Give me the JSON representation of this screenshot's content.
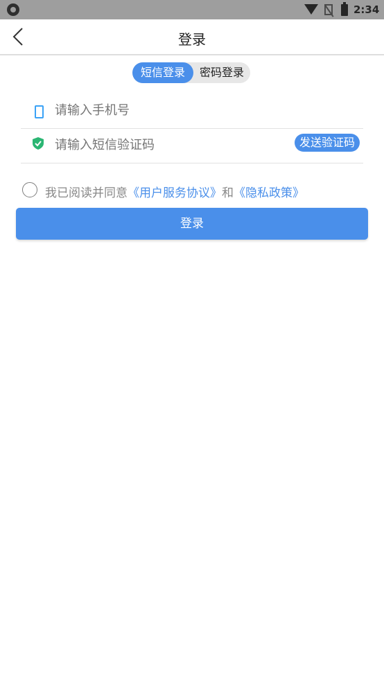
{
  "status_bar": {
    "time": "2:34"
  },
  "header": {
    "title": "登录"
  },
  "tabs": [
    {
      "label": "短信登录",
      "active": true
    },
    {
      "label": "密码登录",
      "active": false
    }
  ],
  "form": {
    "phone_placeholder": "请输入手机号",
    "code_placeholder": "请输入短信验证码",
    "send_code_label": "发送验证码"
  },
  "agreement": {
    "prefix": "我已阅读并同意",
    "terms": "《用户服务协议》",
    "and": "和",
    "privacy": "《隐私政策》"
  },
  "login_button": "登录",
  "colors": {
    "accent": "#4a8fea",
    "shield": "#2bb673",
    "phone_icon": "#3aa2f6"
  }
}
